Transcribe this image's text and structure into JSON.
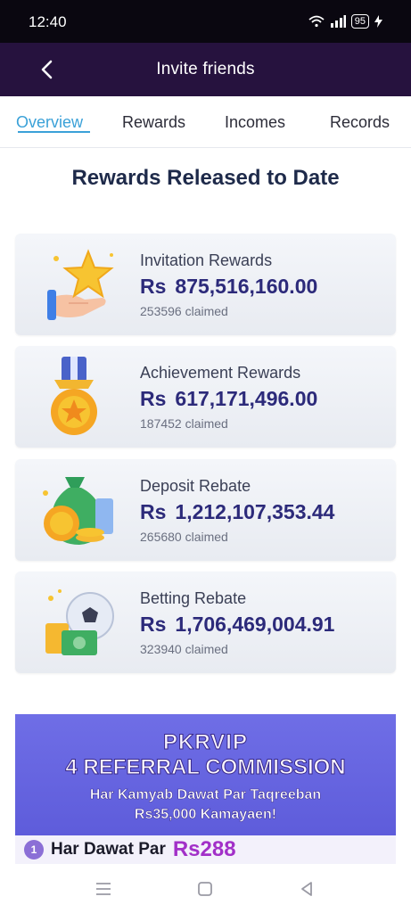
{
  "status_bar": {
    "time": "12:40",
    "battery": "95"
  },
  "header": {
    "title": "Invite friends"
  },
  "tabs": [
    {
      "label": "Overview"
    },
    {
      "label": "Rewards"
    },
    {
      "label": "Incomes"
    },
    {
      "label": "Records"
    }
  ],
  "section_title": "Rewards Released to Date",
  "rewards": [
    {
      "title": "Invitation Rewards",
      "currency": "Rs",
      "amount": "875,516,160.00",
      "claimed": "253596 claimed",
      "icon": "star-hand-icon"
    },
    {
      "title": "Achievement Rewards",
      "currency": "Rs",
      "amount": "617,171,496.00",
      "claimed": "187452 claimed",
      "icon": "medal-icon"
    },
    {
      "title": "Deposit Rebate",
      "currency": "Rs",
      "amount": "1,212,107,353.44",
      "claimed": "265680 claimed",
      "icon": "money-bag-icon"
    },
    {
      "title": "Betting Rebate",
      "currency": "Rs",
      "amount": "1,706,469,004.91",
      "claimed": "323940 claimed",
      "icon": "football-cash-icon"
    }
  ],
  "banner": {
    "brand": "PKRVIP",
    "headline": "4 REFERRAL COMMISSION",
    "line1": "Har Kamyab Dawat Par Taqreeban",
    "line2": "Rs35,000 Kamayaen!",
    "footer_number": "1",
    "footer_text": "Har Dawat Par",
    "footer_amount": "Rs288"
  },
  "colors": {
    "header_bg": "#26123e",
    "tab_active": "#3aa1d8",
    "amount": "#2c2a7a",
    "banner_bg": "#5a58d8"
  }
}
